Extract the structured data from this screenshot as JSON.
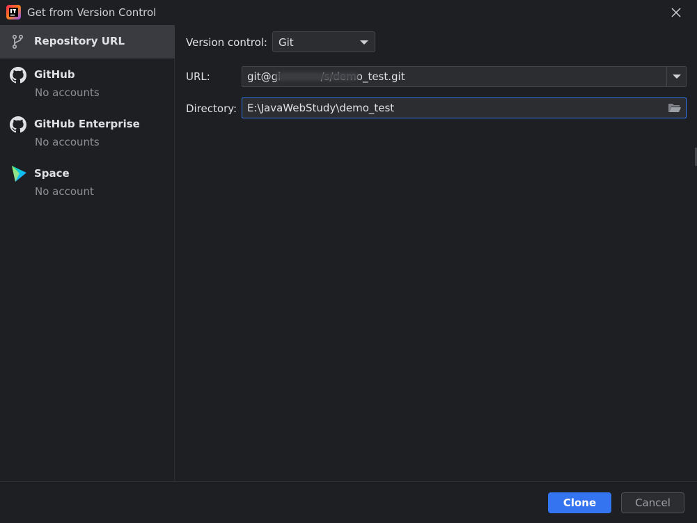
{
  "window": {
    "title": "Get from Version Control"
  },
  "sidebar": {
    "items": [
      {
        "label": "Repository URL",
        "sub": "",
        "icon": "branch-icon",
        "selected": true
      },
      {
        "label": "GitHub",
        "sub": "No accounts",
        "icon": "github-icon",
        "selected": false
      },
      {
        "label": "GitHub Enterprise",
        "sub": "No accounts",
        "icon": "github-icon",
        "selected": false
      },
      {
        "label": "Space",
        "sub": "No account",
        "icon": "space-icon",
        "selected": false
      }
    ]
  },
  "form": {
    "version_control_label": "Version control:",
    "version_control_value": "Git",
    "url_label": "URL:",
    "url_value": "git@gi            /s/demo_test.git",
    "directory_label": "Directory:",
    "directory_value": "E:\\JavaWebStudy\\demo_test"
  },
  "footer": {
    "clone_label": "Clone",
    "cancel_label": "Cancel"
  },
  "colors": {
    "background": "#1e1f22",
    "selected_item": "#393b40",
    "accent": "#3574f0",
    "field": "#2b2d30"
  }
}
